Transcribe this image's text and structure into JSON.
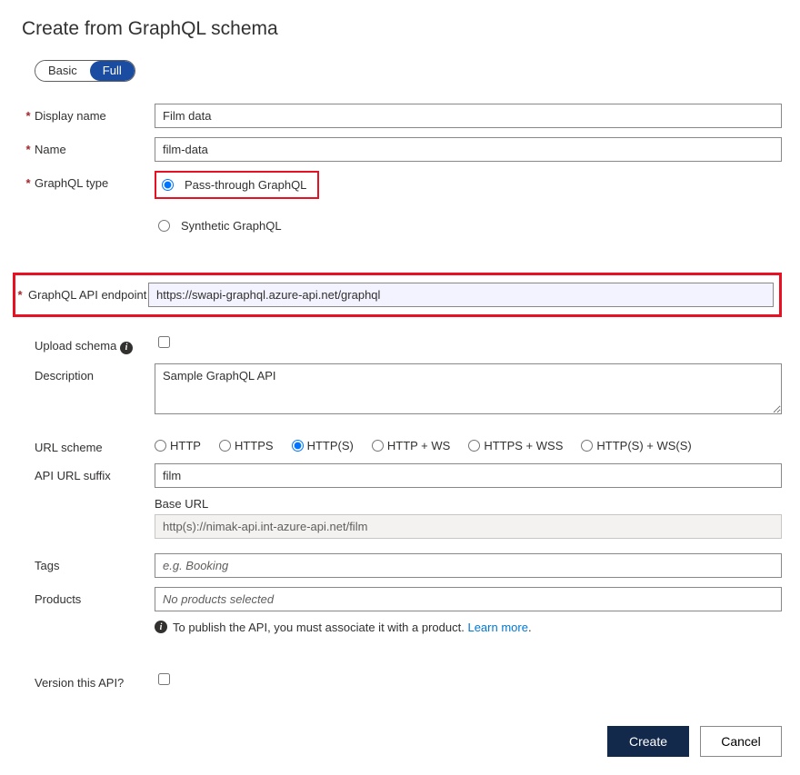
{
  "title": "Create from GraphQL schema",
  "toggle": {
    "basic": "Basic",
    "full": "Full"
  },
  "labels": {
    "displayName": "Display name",
    "name": "Name",
    "graphqlType": "GraphQL type",
    "graphqlEndpoint": "GraphQL API endpoint",
    "uploadSchema": "Upload schema",
    "description": "Description",
    "urlScheme": "URL scheme",
    "apiUrlSuffix": "API URL suffix",
    "baseUrl": "Base URL",
    "tags": "Tags",
    "products": "Products",
    "versionThisApi": "Version this API?"
  },
  "values": {
    "displayName": "Film data",
    "name": "film-data",
    "endpoint": "https://swapi-graphql.azure-api.net/graphql",
    "description": "Sample GraphQL API",
    "apiUrlSuffix": "film",
    "baseUrl": "http(s)://nimak-api.int-azure-api.net/film"
  },
  "graphqlTypes": {
    "passThrough": "Pass-through GraphQL",
    "synthetic": "Synthetic GraphQL"
  },
  "urlSchemes": {
    "http": "HTTP",
    "https": "HTTPS",
    "httpBoth": "HTTP(S)",
    "httpWs": "HTTP + WS",
    "httpsWss": "HTTPS + WSS",
    "httpBothWs": "HTTP(S) + WS(S)"
  },
  "placeholders": {
    "tags": "e.g. Booking",
    "products": "No products selected"
  },
  "publishInfo": {
    "text": "To publish the API, you must associate it with a product.",
    "linkText": "Learn more",
    "period": "."
  },
  "buttons": {
    "create": "Create",
    "cancel": "Cancel"
  }
}
